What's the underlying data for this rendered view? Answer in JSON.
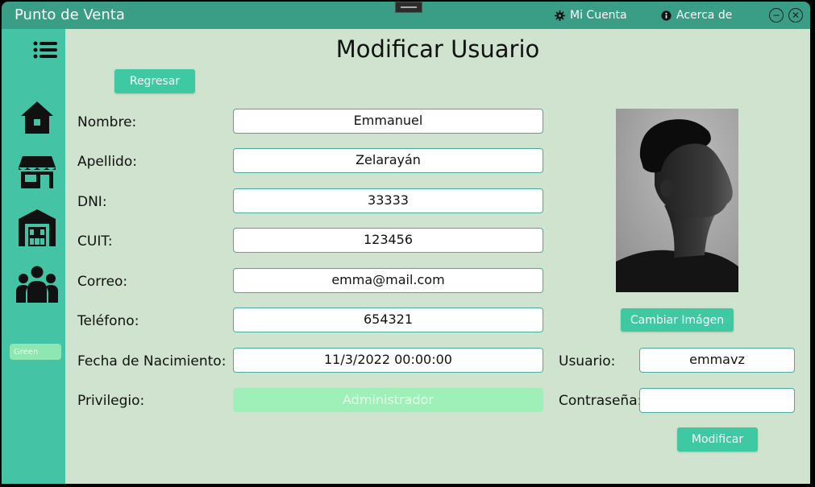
{
  "window": {
    "title": "Punto de Venta",
    "links": {
      "account": "Mi Cuenta",
      "about": "Acerca de"
    }
  },
  "sidebar": {
    "items": [
      "menu-icon",
      "home-icon",
      "store-icon",
      "warehouse-icon",
      "users-icon"
    ],
    "theme_label": "Green"
  },
  "page": {
    "title": "Modificar Usuario",
    "back_button": "Regresar",
    "change_image_button": "Cambiar Imágen",
    "submit_button": "Modificar"
  },
  "form": {
    "nombre": {
      "label": "Nombre:",
      "value": "Emmanuel"
    },
    "apellido": {
      "label": "Apellido:",
      "value": "Zelarayán"
    },
    "dni": {
      "label": "DNI:",
      "value": "33333"
    },
    "cuit": {
      "label": "CUIT:",
      "value": "123456"
    },
    "correo": {
      "label": "Correo:",
      "value": "emma@mail.com"
    },
    "telefono": {
      "label": "Teléfono:",
      "value": "654321"
    },
    "fecha": {
      "label": "Fecha de Nacimiento:",
      "value": "11/3/2022 00:00:00"
    },
    "privilegio": {
      "label": "Privilegio:",
      "value": "Administrador"
    },
    "usuario": {
      "label": "Usuario:",
      "value": "emmavz"
    },
    "contrasena": {
      "label": "Contraseña:",
      "value": ""
    }
  },
  "colors": {
    "titlebar": "#3a9d86",
    "sidebar": "#45c4a5",
    "content_bg": "#cfe3cf",
    "button": "#3fc9a2",
    "select": "#9ef0b8"
  }
}
